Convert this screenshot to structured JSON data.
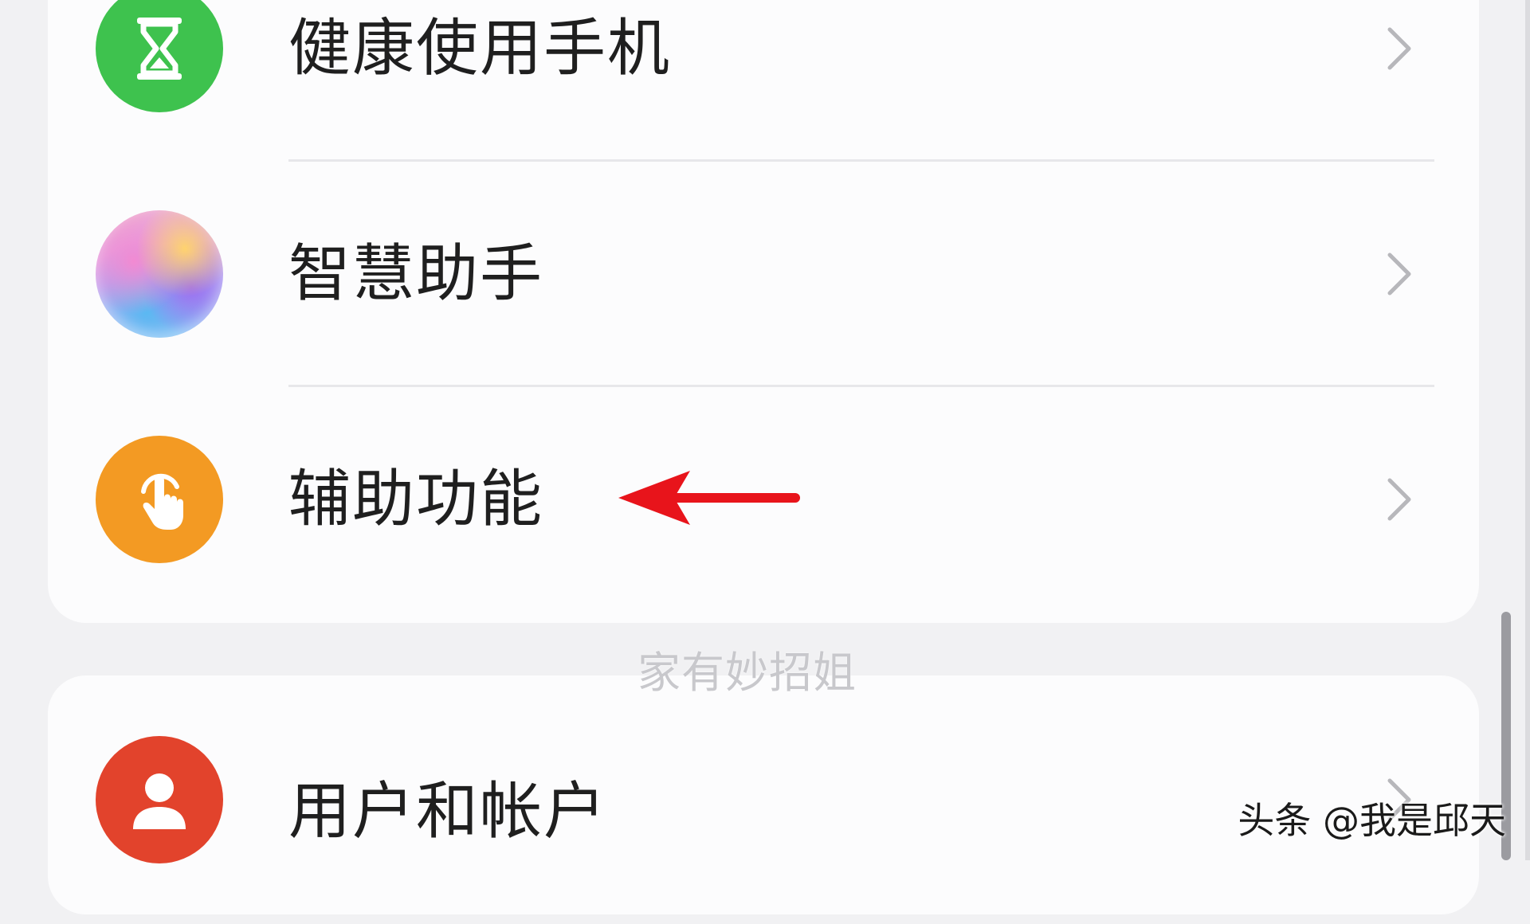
{
  "settings": {
    "items": [
      {
        "label": "健康使用手机",
        "icon": "hourglass-icon",
        "color": "#3ec24e"
      },
      {
        "label": "智慧助手",
        "icon": "assistant-orb-icon",
        "color": "#d79af0"
      },
      {
        "label": "辅助功能",
        "icon": "tap-hand-icon",
        "color": "#f39a23"
      },
      {
        "label": "用户和帐户",
        "icon": "user-icon",
        "color": "#e2432c"
      }
    ]
  },
  "annotation": {
    "arrow_color": "#e8141b"
  },
  "watermark": {
    "text": "家有妙招姐"
  },
  "source": {
    "text": "头条 @我是邱天"
  }
}
